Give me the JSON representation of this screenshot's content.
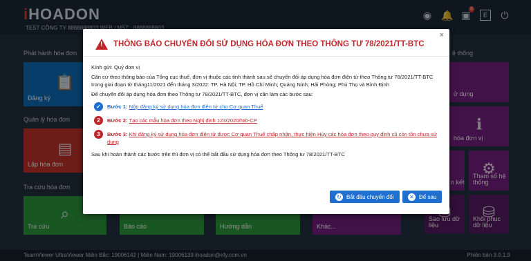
{
  "app": {
    "logo_i": "i",
    "logo_rest": "HOADON",
    "company": "TEST CÔNG TY 8888888803 WEB | MST : 8888888803",
    "notification_count": "6"
  },
  "sections": {
    "issue": "Phát hành hóa đơn",
    "manage": "Quản lý hóa đơn",
    "lookup": "Tra cứu hóa đơn",
    "system": "ệ thống"
  },
  "tiles": {
    "register": "Đăng ký",
    "create": "Lập hóa đơn",
    "lookup": "Tra cứu",
    "report": "Báo cáo",
    "guide": "Hướng dẫn",
    "other": "Khác...",
    "usage": "ử dụng",
    "invoice_type": "hóa đơn vị",
    "connect": "n kết",
    "params": "Tham số hệ thống",
    "backup": "Sao lưu dữ liệu",
    "restore": "Khôi phục dữ liệu"
  },
  "footer": {
    "left": "TeamViewer   UltraViewer   Miền Bắc: 19006142 | Miền Nam: 19006139   ihoadon@efy.com.vn",
    "version": "Phiên bản 3.0.1.9"
  },
  "modal": {
    "title": "THÔNG BÁO CHUYỂN ĐỔI SỬ DỤNG HÓA ĐƠN THEO THÔNG TƯ 78/2021/TT-BTC",
    "greeting": "Kính gửi: Quý đơn vị",
    "para1": "Căn cứ theo thông báo của Tổng cục thuế, đơn vị thuộc các tỉnh thành sau sẽ chuyển đổi áp dụng hóa đơn điện tử theo Thông tư 78/2021/TT-BTC trong giai đoạn từ tháng11/2021 đến tháng 3/2022: TP. Hà Nội; TP. Hồ Chí Minh; Quảng Ninh; Hải Phòng; Phú Thọ và Bình Định",
    "para2": "Để chuyển đổi áp dụng hóa đơn theo Thông tư 78/2021/TT-BTC, đơn vị cần làm các bước sau:",
    "steps": [
      {
        "num": "✓",
        "label": "Bước 1:",
        "link": "Nộp đăng ký sử dụng hóa đơn điện tử cho Cơ quan Thuế"
      },
      {
        "num": "2",
        "label": "Bước 2:",
        "link": "Tạo các mẫu hóa đơn theo Nghị định 123/2020/NĐ-CP"
      },
      {
        "num": "3",
        "label": "Bước 3:",
        "link": "Khi đăng ký sử dụng hóa đơn điện tử được Cơ quan Thuế chấp nhận, thực hiện Hủy các hóa đơn theo quy định cũ còn tồn chưa sử dụng"
      }
    ],
    "final": "Sau khi hoàn thành các bước trên thì đơn vị có thể bắt đầu sử dụng hóa đơn theo Thông tư 78/2021/TT-BTC",
    "btn_start": "Bắt đầu chuyển đổi",
    "btn_later": "Để sau",
    "close": "×"
  },
  "colors": {
    "accent_blue": "#1e6fd0",
    "alert_red": "#c0272d",
    "tile_blue": "#0c72c0",
    "tile_red": "#c9342a",
    "tile_green": "#2e9e3f",
    "tile_purple": "#7a1f86"
  }
}
